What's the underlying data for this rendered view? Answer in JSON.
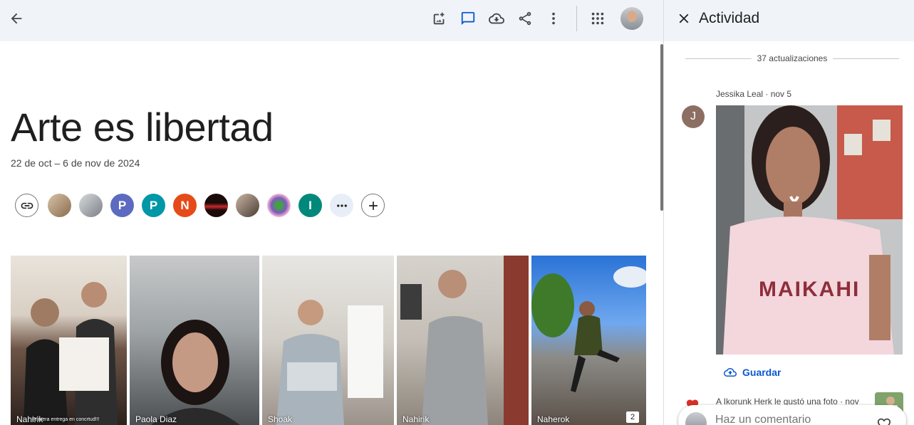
{
  "album": {
    "title": "Arte es libertad",
    "dates": "22 de oct – 6 de nov de 2024"
  },
  "toolbar": {
    "icons": [
      "back-arrow-icon",
      "add-photo-icon",
      "comment-icon",
      "download-cloud-icon",
      "share-icon",
      "more-vert-icon",
      "apps-grid-icon"
    ],
    "accent": "#0b57d0"
  },
  "people": [
    {
      "kind": "link",
      "icon": "link-icon"
    },
    {
      "kind": "photo",
      "color": "#b89c7d"
    },
    {
      "kind": "photo",
      "color": "#9aa0a6"
    },
    {
      "kind": "letter",
      "letter": "P",
      "color": "#5c6bc0"
    },
    {
      "kind": "letter",
      "letter": "P",
      "color": "#0097a7"
    },
    {
      "kind": "letter",
      "letter": "N",
      "color": "#e64a19"
    },
    {
      "kind": "photo",
      "color": "#5d1d1d"
    },
    {
      "kind": "photo",
      "color": "#6e5a4e"
    },
    {
      "kind": "photo",
      "color": "#7e57c2"
    },
    {
      "kind": "letter",
      "letter": "I",
      "color": "#00897b"
    },
    {
      "kind": "more",
      "icon": "more-horiz-icon"
    },
    {
      "kind": "add",
      "icon": "add-icon"
    }
  ],
  "photos": [
    {
      "caption": "Nahirik",
      "extra": "Primera entrega en concrtud!!!"
    },
    {
      "caption": "Paola Diaz"
    },
    {
      "caption": "Shoak"
    },
    {
      "caption": "Nahirik"
    },
    {
      "caption": "Naherok",
      "count": "2"
    }
  ],
  "activity": {
    "title": "Actividad",
    "updates": "37 actualizaciones",
    "item_meta": "Jessika Leal · nov 5",
    "item_avatar_letter": "J",
    "save_label": "Guardar",
    "like_text": "A Ikorunk Herk le gustó una foto · nov",
    "comment_placeholder": "Haz un comentario",
    "heart_color": "#d93025"
  }
}
